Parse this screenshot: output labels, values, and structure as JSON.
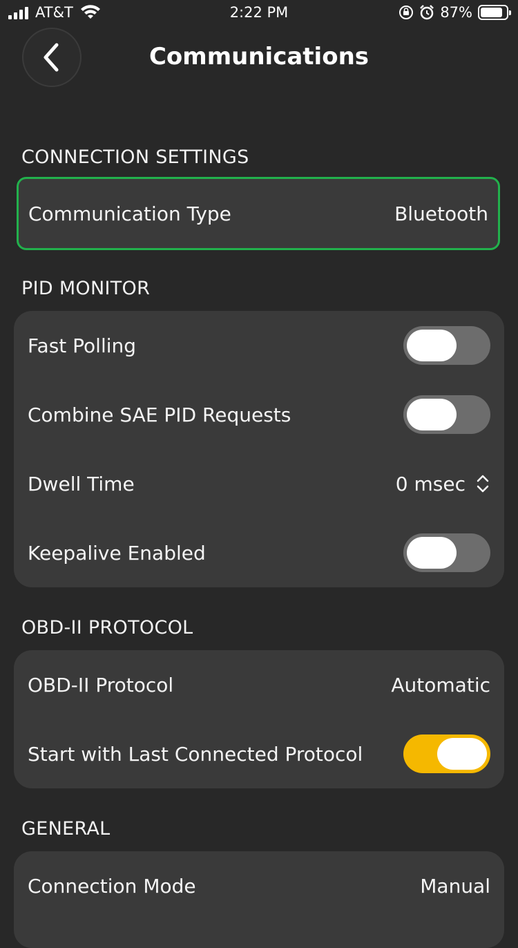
{
  "status_bar": {
    "carrier": "AT&T",
    "time": "2:22 PM",
    "battery": "87%",
    "battery_level": 0.87
  },
  "header": {
    "title": "Communications",
    "back_icon": "chevron-left-icon"
  },
  "sections": {
    "connection": {
      "header": "CONNECTION SETTINGS",
      "communication_type": {
        "label": "Communication Type",
        "value": "Bluetooth"
      }
    },
    "pid_monitor": {
      "header": "PID MONITOR",
      "fast_polling": {
        "label": "Fast Polling",
        "on": false
      },
      "combine_sae": {
        "label": "Combine SAE PID Requests",
        "on": false
      },
      "dwell_time": {
        "label": "Dwell Time",
        "value": "0 msec"
      },
      "keepalive": {
        "label": "Keepalive Enabled",
        "on": false
      }
    },
    "obd_protocol": {
      "header": "OBD-II PROTOCOL",
      "protocol": {
        "label": "OBD-II Protocol",
        "value": "Automatic"
      },
      "start_last": {
        "label": "Start with Last Connected Protocol",
        "on": true
      }
    },
    "general": {
      "header": "GENERAL",
      "connection_mode": {
        "label": "Connection Mode",
        "value": "Manual"
      }
    }
  },
  "colors": {
    "background": "#282828",
    "card": "#3a3a3a",
    "accent_green": "#22b14c",
    "accent_yellow": "#f5b800",
    "toggle_off": "#6d6d6d"
  }
}
